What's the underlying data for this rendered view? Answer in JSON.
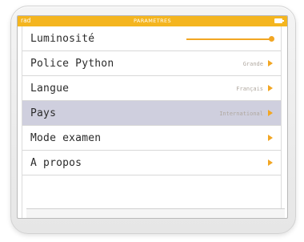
{
  "statusbar": {
    "mode": "rad",
    "title": "PARAMETRES",
    "battery_icon": "battery-icon"
  },
  "menu": {
    "items": [
      {
        "label": "Luminosité",
        "value": "",
        "control": "slider",
        "level": 1.0
      },
      {
        "label": "Police Python",
        "value": "Grande",
        "control": "arrow"
      },
      {
        "label": "Langue",
        "value": "Français",
        "control": "arrow"
      },
      {
        "label": "Pays",
        "value": "International",
        "control": "arrow",
        "selected": true
      },
      {
        "label": "Mode examen",
        "value": "",
        "control": "arrow"
      },
      {
        "label": "A propos",
        "value": "",
        "control": "arrow"
      }
    ]
  },
  "colors": {
    "accent": "#f2a623",
    "titlebar": "#f4b51f",
    "selected_row": "#cfcfde"
  }
}
